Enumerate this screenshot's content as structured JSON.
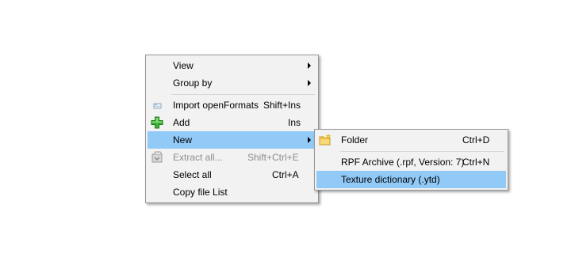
{
  "main_menu": {
    "items": [
      {
        "label": "View",
        "shortcut": ""
      },
      {
        "label": "Group by",
        "shortcut": ""
      },
      {
        "label": "Import openFormats",
        "shortcut": "Shift+Ins"
      },
      {
        "label": "Add",
        "shortcut": "Ins"
      },
      {
        "label": "New",
        "shortcut": ""
      },
      {
        "label": "Extract all...",
        "shortcut": "Shift+Ctrl+E"
      },
      {
        "label": "Select all",
        "shortcut": "Ctrl+A"
      },
      {
        "label": "Copy file List",
        "shortcut": ""
      }
    ]
  },
  "sub_menu": {
    "items": [
      {
        "label": "Folder",
        "shortcut": "Ctrl+D"
      },
      {
        "label": "RPF Archive (.rpf, Version: 7)",
        "shortcut": "Ctrl+N"
      },
      {
        "label": "Texture dictionary (.ytd)",
        "shortcut": ""
      }
    ]
  },
  "colors": {
    "highlight": "#91c9f7",
    "menu_bg": "#f2f2f2",
    "disabled_text": "#8d8d8d"
  }
}
